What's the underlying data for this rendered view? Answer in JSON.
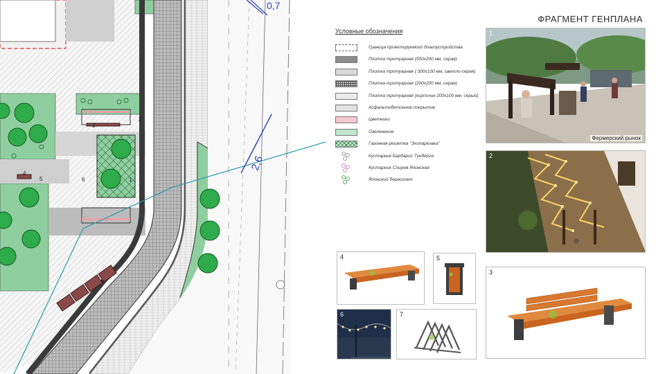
{
  "title": "ФРАГМЕНТ ГЕНПЛАНА",
  "plan": {
    "elevations": [
      "0,7",
      "2,6"
    ],
    "markers": [
      "1",
      "2",
      "3",
      "4",
      "5",
      "6"
    ]
  },
  "legend": {
    "title": "Условные обозначения",
    "items": [
      {
        "label": "Граница проектируемого благоустройства",
        "swatch": "boundary"
      },
      {
        "label": "Плитка тротуарная (500х200 мм, серая)",
        "swatch": "#8c8c8c"
      },
      {
        "label": "Плитка тротуарная ( 300х100 мм, светло-серая)",
        "swatch": "#d9d9d9"
      },
      {
        "label": "Плитка тротуарная (200х200 мм, серая)",
        "swatch": "grid"
      },
      {
        "label": "Плитка тротуарная (кирпичик 200х100 мм, серый)",
        "swatch": "#ececec"
      },
      {
        "label": "Асфальтобетонное покрытие",
        "swatch": "#e3e3e3"
      },
      {
        "label": "Цветники",
        "swatch": "#f7c9cf"
      },
      {
        "label": "Озеленение",
        "swatch": "#bfe8cc"
      },
      {
        "label": "Газонная решетка \"Экопарковка\"",
        "swatch": "eco"
      },
      {
        "label": "Кустарник Барбарис Тунберга",
        "swatch": "shrub-grey"
      },
      {
        "label": "Кустарник Спирея Японская",
        "swatch": "shrub-pink"
      },
      {
        "label": "Японский бересклет",
        "swatch": "shrub-green"
      }
    ]
  },
  "photos": [
    {
      "number": "1",
      "caption": "Фермерский рынок"
    },
    {
      "number": "2",
      "caption": ""
    },
    {
      "number": "3",
      "caption": ""
    },
    {
      "number": "4",
      "caption": ""
    },
    {
      "number": "5",
      "caption": ""
    },
    {
      "number": "6",
      "caption": ""
    },
    {
      "number": "7",
      "caption": ""
    }
  ],
  "colors": {
    "green_fill": "#8fcf9f",
    "tree": "#2eab4a",
    "flowerbed": "#e8a0a8",
    "bench_wood": "#d9782e",
    "bench_steel": "#4a4a4a"
  }
}
